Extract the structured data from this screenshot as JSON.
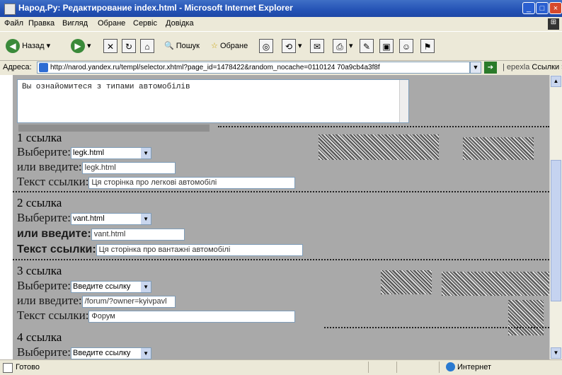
{
  "window": {
    "title": "Народ.Ру: Редактирование index.html - Microsoft Internet Explorer",
    "controls": [
      "_",
      "□",
      "×"
    ]
  },
  "menu": [
    "Файл",
    "Правка",
    "Вигляд",
    "Обране",
    "Сервіс",
    "Довідка"
  ],
  "toolbar": {
    "back_label": "Назад",
    "search_label": "Пошук",
    "favorites_label": "Обране"
  },
  "address": {
    "label": "Адреса:",
    "url": "http://narod.yandex.ru/templ/selector.xhtml?page_id=1478422&random_nocache=0110124 70a9cb4a3f8f",
    "go_icon": "go-arrow-icon",
    "links_label": "Ссылки"
  },
  "editor": {
    "textarea_text": "Вы ознайомитеся з типами автомобілів"
  },
  "link_blocks": [
    {
      "heading": "1 ссылка",
      "choose_label": "Выберите:",
      "choose_value": "legk.html",
      "or_label": "или введите:",
      "or_value": "legk.html",
      "text_label": "Текст ссылки:",
      "text_value": "Ця сторінка про легкові автомобілі"
    },
    {
      "heading": "2 ссылка",
      "choose_label": "Выберите:",
      "choose_value": "vant.html",
      "or_label": "или введите:",
      "or_value": "vant.html",
      "text_label": "Текст ссылки:",
      "text_value": "Ця сторінка про вантажні автомобілі"
    },
    {
      "heading": "3 ссылка",
      "choose_label": "Выберите:",
      "choose_value": "Введите ссылку",
      "or_label": "или введите:",
      "or_value": "/forum/?owner=kyivpavl",
      "text_label": "Текст ссылки:",
      "text_value": "Форум"
    },
    {
      "heading": "4 ссылка",
      "choose_label": "Выберите:",
      "choose_value": "Введите ссылку"
    }
  ],
  "status": {
    "text": "Готово",
    "zone": "Интернет"
  }
}
